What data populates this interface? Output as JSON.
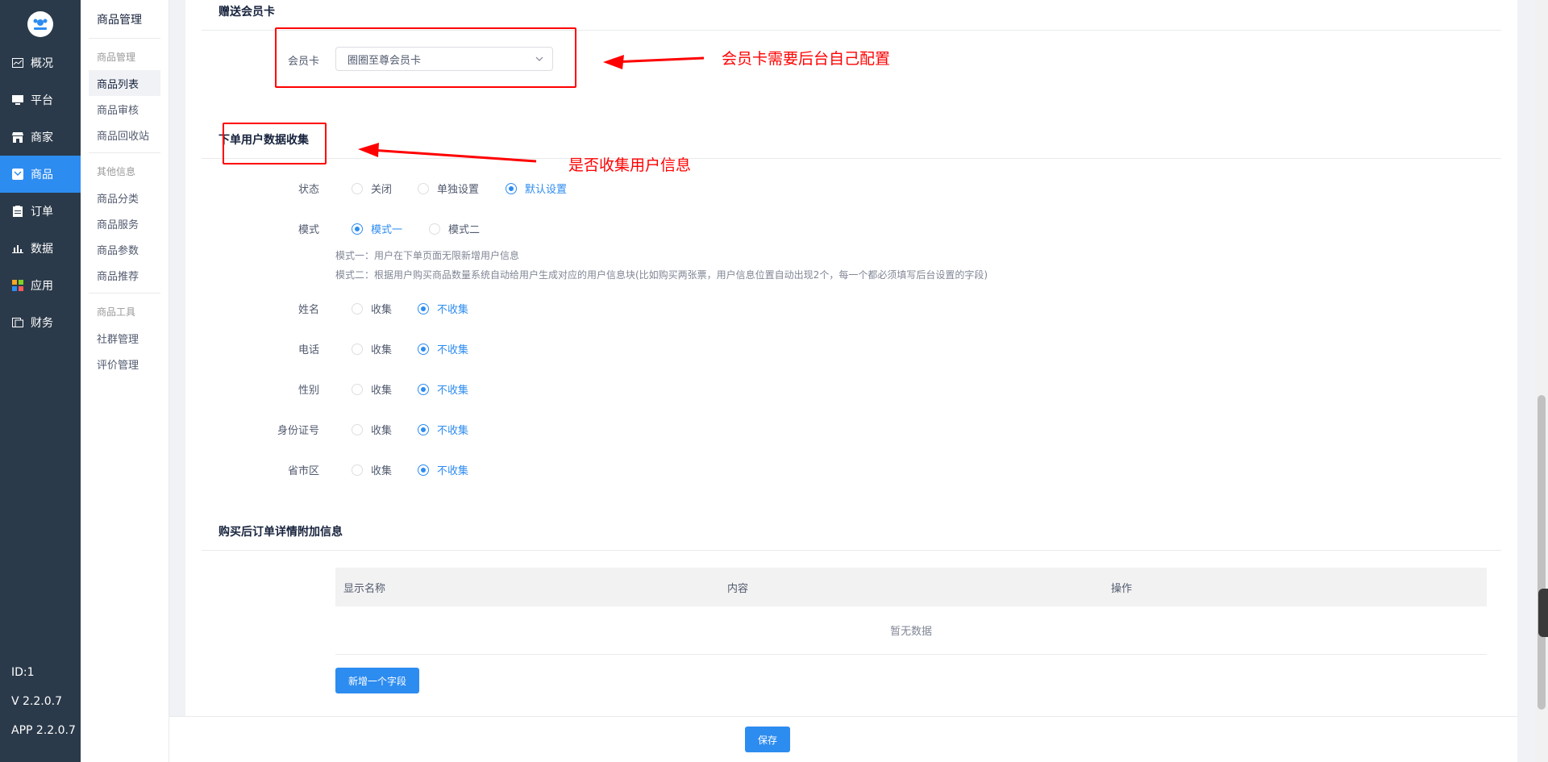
{
  "sidebar": {
    "items": [
      {
        "label": "概况",
        "icon": "chart-icon"
      },
      {
        "label": "平台",
        "icon": "monitor-icon"
      },
      {
        "label": "商家",
        "icon": "store-icon"
      },
      {
        "label": "商品",
        "icon": "goods-icon"
      },
      {
        "label": "订单",
        "icon": "order-icon"
      },
      {
        "label": "数据",
        "icon": "bar-chart-icon"
      },
      {
        "label": "应用",
        "icon": "apps-icon"
      },
      {
        "label": "财务",
        "icon": "finance-icon"
      }
    ],
    "active_index": 3,
    "id_text": "ID:1",
    "version": "V 2.2.0.7",
    "app_version": "APP 2.2.0.7"
  },
  "submenu": {
    "title": "商品管理",
    "groups": [
      {
        "name": "商品管理",
        "items": [
          "商品列表",
          "商品审核",
          "商品回收站"
        ]
      },
      {
        "name": "其他信息",
        "items": [
          "商品分类",
          "商品服务",
          "商品参数",
          "商品推荐"
        ]
      },
      {
        "name": "商品工具",
        "items": [
          "社群管理",
          "评价管理"
        ]
      }
    ],
    "active_item": "商品列表"
  },
  "gift_card": {
    "section_title": "赠送会员卡",
    "label": "会员卡",
    "selected": "圈圈至尊会员卡"
  },
  "collect": {
    "section_title": "下单用户数据收集",
    "status": {
      "label": "状态",
      "options": [
        "关闭",
        "单独设置",
        "默认设置"
      ],
      "selected": 2
    },
    "mode": {
      "label": "模式",
      "options": [
        "模式一",
        "模式二"
      ],
      "selected": 0
    },
    "hint1": "模式一：用户在下单页面无限新增用户信息",
    "hint2": "模式二：根据用户购买商品数量系统自动给用户生成对应的用户信息块(比如购买两张票，用户信息位置自动出现2个，每一个都必须填写后台设置的字段)",
    "fields": [
      {
        "label": "姓名",
        "options": [
          "收集",
          "不收集"
        ],
        "selected": 1
      },
      {
        "label": "电话",
        "options": [
          "收集",
          "不收集"
        ],
        "selected": 1
      },
      {
        "label": "性别",
        "options": [
          "收集",
          "不收集"
        ],
        "selected": 1
      },
      {
        "label": "身份证号",
        "options": [
          "收集",
          "不收集"
        ],
        "selected": 1
      },
      {
        "label": "省市区",
        "options": [
          "收集",
          "不收集"
        ],
        "selected": 1
      }
    ]
  },
  "extra": {
    "section_title": "购买后订单详情附加信息",
    "columns": [
      "显示名称",
      "内容",
      "操作"
    ],
    "empty_text": "暂无数据",
    "add_button": "新增一个字段"
  },
  "footer": {
    "save_button": "保存"
  },
  "annotations": {
    "card_note": "会员卡需要后台自己配置",
    "collect_note": "是否收集用户信息",
    "color": "#ff0000"
  },
  "colors": {
    "primary": "#2d8cf0",
    "sidebar_bg": "#2b3a4a"
  }
}
